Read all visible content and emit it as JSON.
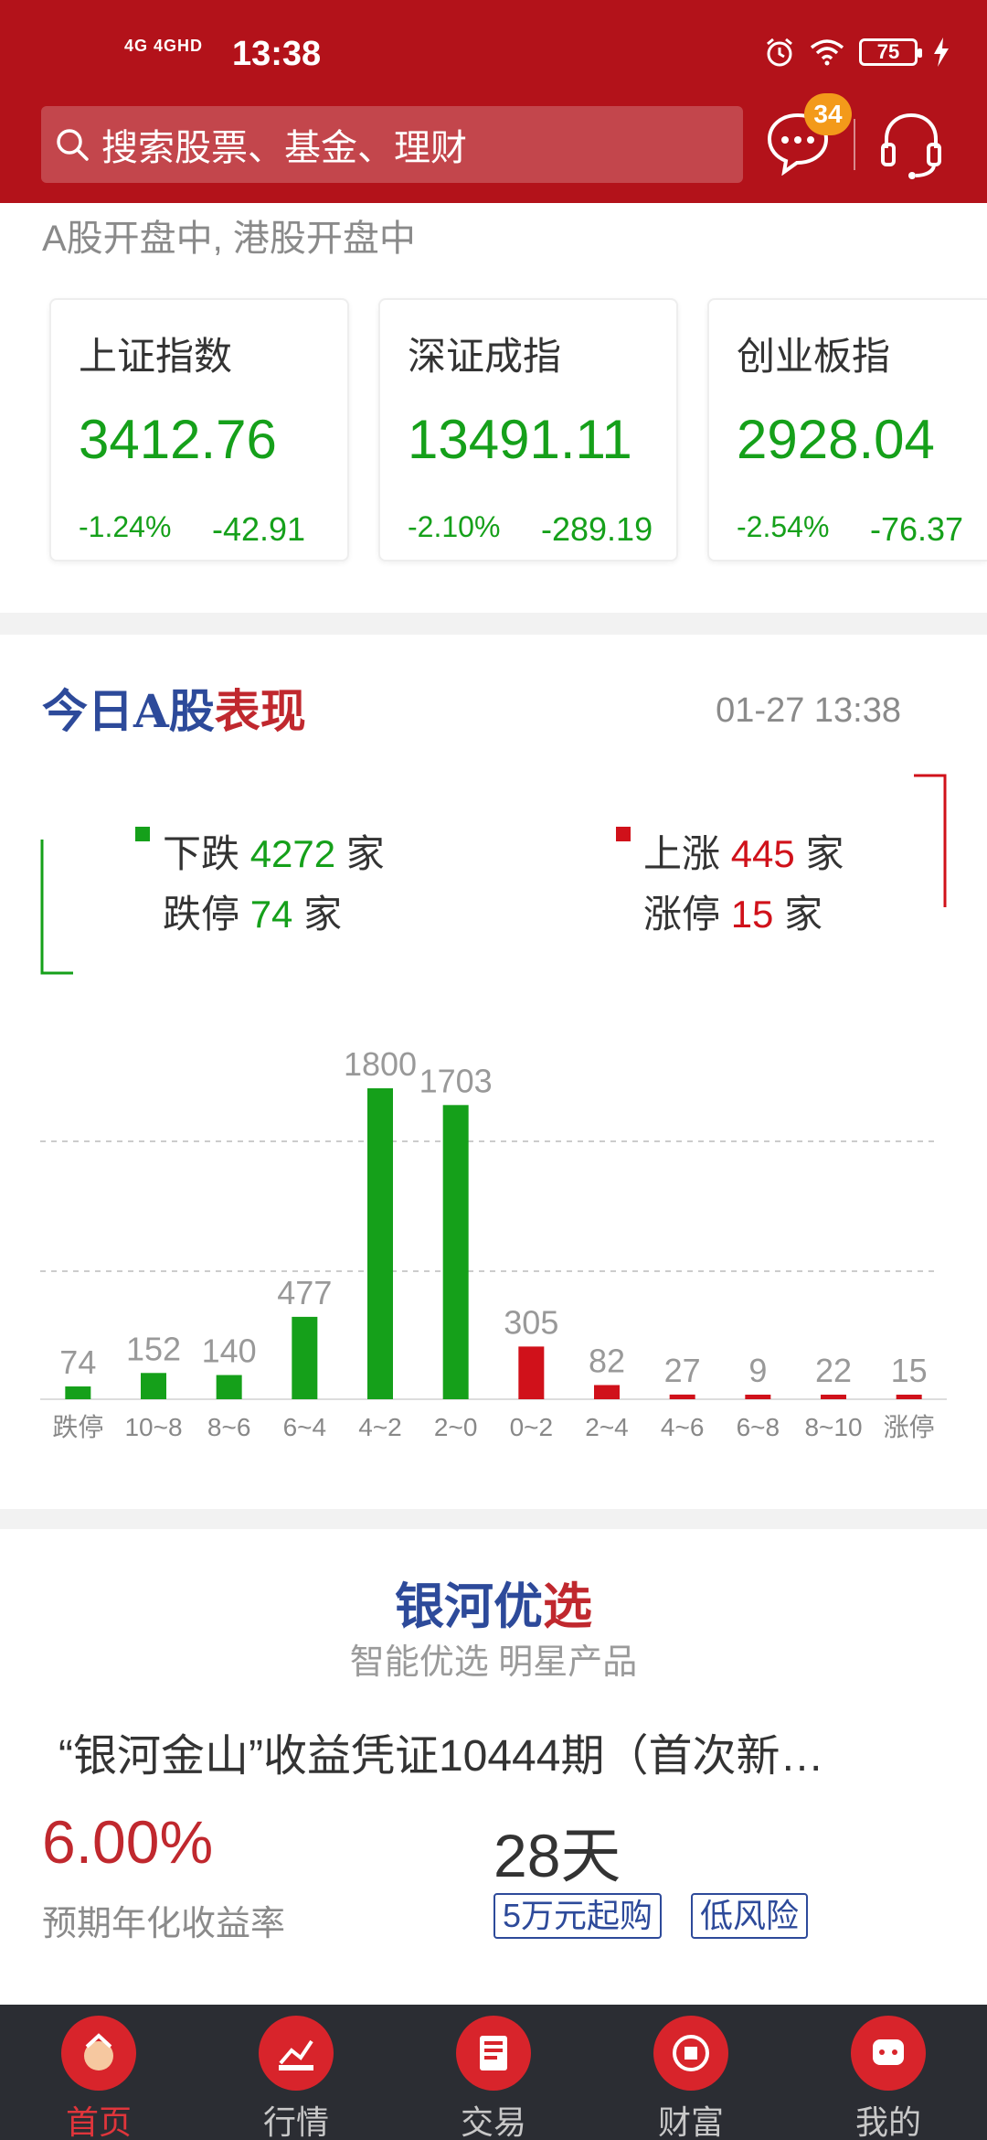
{
  "status_bar": {
    "signal": "4G 4GHD",
    "time": "13:38",
    "battery": "75"
  },
  "search": {
    "placeholder": "搜索股票、基金、理财"
  },
  "messages": {
    "badge_count": "34"
  },
  "market_status": "A股开盘中, 港股开盘中",
  "indices": [
    {
      "name": "上证指数",
      "value": "3412.76",
      "pct": "-1.24%",
      "change": "-42.91"
    },
    {
      "name": "深证成指",
      "value": "13491.11",
      "pct": "-2.10%",
      "change": "-289.19"
    },
    {
      "name": "创业板指",
      "value": "2928.04",
      "pct": "-2.54%",
      "change": "-76.37"
    }
  ],
  "today": {
    "title_part1": "今日A股",
    "title_part2": "表现",
    "time": "01-27 13:38",
    "down_label": "下跌",
    "down_count": "4272",
    "up_label": "上涨",
    "up_count": "445",
    "limit_down_label": "跌停",
    "limit_down_count": "74",
    "limit_up_label": "涨停",
    "limit_up_count": "15",
    "unit": "家",
    "colors": {
      "down": "#15a01a",
      "up": "#d0111a"
    }
  },
  "chart_data": {
    "type": "bar",
    "categories": [
      "跌停",
      "10~8",
      "8~6",
      "6~4",
      "4~2",
      "2~0",
      "0~2",
      "2~4",
      "4~6",
      "6~8",
      "8~10",
      "涨停"
    ],
    "values": [
      74,
      152,
      140,
      477,
      1800,
      1703,
      305,
      82,
      27,
      9,
      22,
      15
    ],
    "colors": [
      "#15a01a",
      "#15a01a",
      "#15a01a",
      "#15a01a",
      "#15a01a",
      "#15a01a",
      "#d0111a",
      "#d0111a",
      "#d0111a",
      "#d0111a",
      "#d0111a",
      "#d0111a"
    ],
    "grid": "dashed",
    "title": "",
    "xlabel": "",
    "ylabel": ""
  },
  "yinhe": {
    "title_part1": "银河优",
    "title_part2": "选",
    "subtitle": "智能优选 明星产品",
    "product_name": "“银河金山”收益凭证10444期（首次新…",
    "yield": "6.00%",
    "yield_label": "预期年化收益率",
    "term": "28天",
    "tags": [
      "5万元起购",
      "低风险"
    ]
  },
  "bottom_nav": [
    {
      "label": "首页",
      "icon": "home-icon"
    },
    {
      "label": "行情",
      "icon": "market-icon"
    },
    {
      "label": "交易",
      "icon": "trade-icon"
    },
    {
      "label": "财富",
      "icon": "wealth-icon"
    },
    {
      "label": "我的",
      "icon": "profile-icon"
    }
  ]
}
